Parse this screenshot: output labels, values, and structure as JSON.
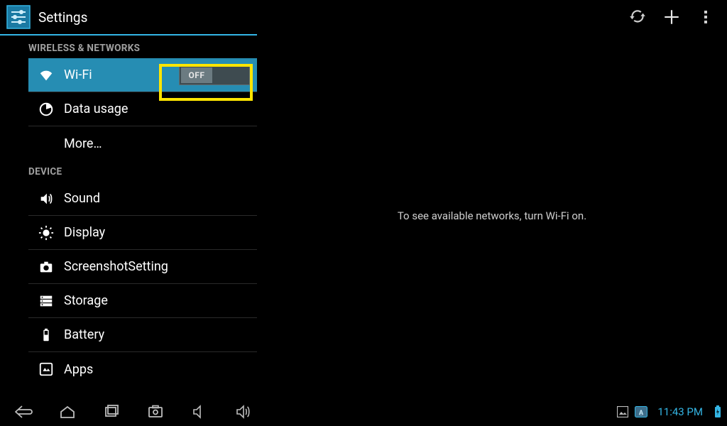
{
  "action_bar": {
    "title": "Settings"
  },
  "sidebar": {
    "sections": [
      {
        "header": "WIRELESS & NETWORKS",
        "items": [
          {
            "id": "wifi",
            "label": "Wi-Fi",
            "icon": "wifi",
            "selected": true,
            "toggle": "OFF"
          },
          {
            "id": "data",
            "label": "Data usage",
            "icon": "data"
          },
          {
            "id": "more",
            "label": "More…",
            "icon": ""
          }
        ]
      },
      {
        "header": "DEVICE",
        "items": [
          {
            "id": "sound",
            "label": "Sound",
            "icon": "sound"
          },
          {
            "id": "display",
            "label": "Display",
            "icon": "display"
          },
          {
            "id": "screenshot",
            "label": "ScreenshotSetting",
            "icon": "camera"
          },
          {
            "id": "storage",
            "label": "Storage",
            "icon": "storage"
          },
          {
            "id": "battery",
            "label": "Battery",
            "icon": "battery"
          },
          {
            "id": "apps",
            "label": "Apps",
            "icon": "apps"
          }
        ]
      }
    ]
  },
  "detail": {
    "message": "To see available networks, turn Wi-Fi on."
  },
  "navbar": {
    "time": "11:43 PM"
  }
}
